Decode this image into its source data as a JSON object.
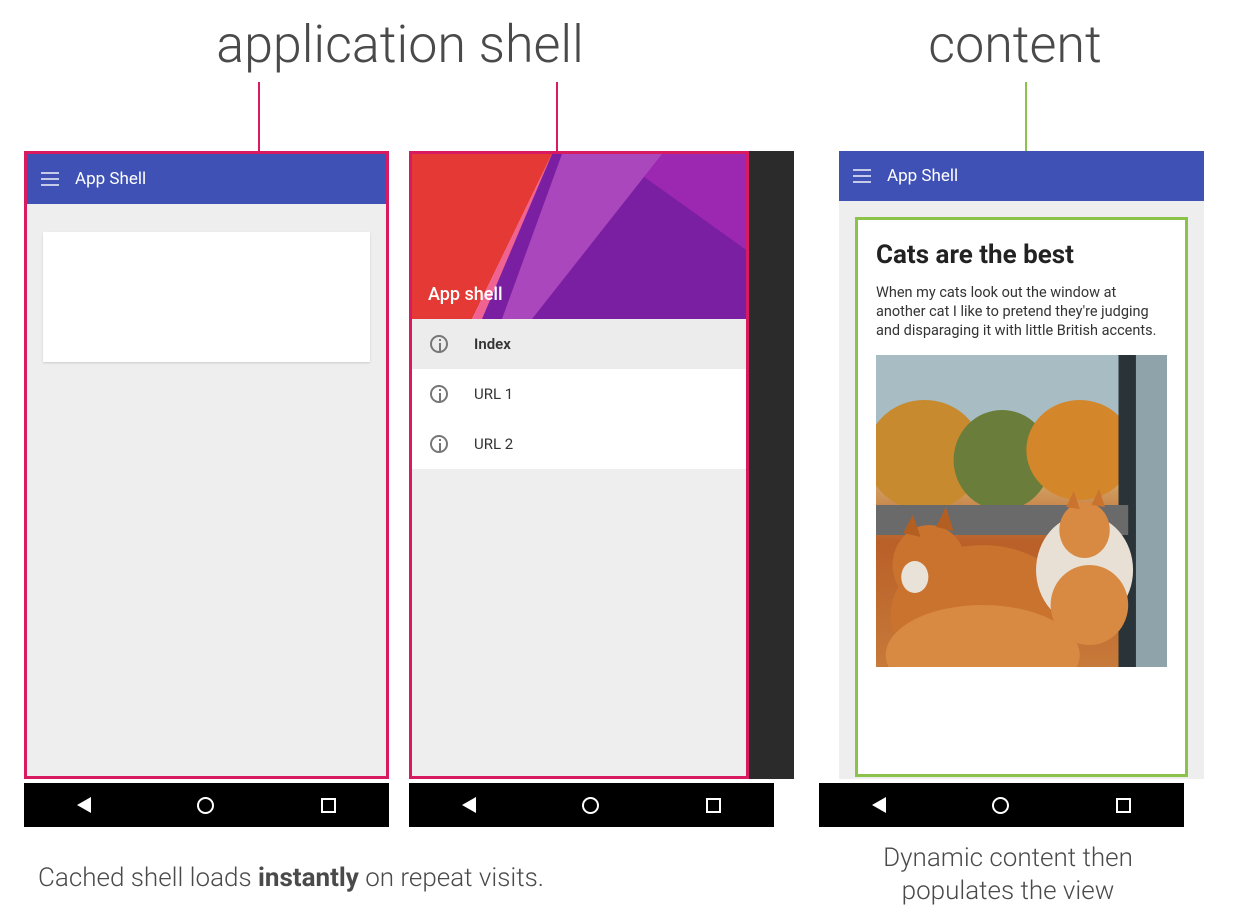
{
  "titles": {
    "left": "application shell",
    "right": "content"
  },
  "colors": {
    "appbar": "#3f51b5",
    "highlight_pink": "#d81b60",
    "highlight_green": "#8bc34a"
  },
  "appbar": {
    "title": "App Shell"
  },
  "drawer": {
    "header_title": "App shell",
    "items": [
      {
        "label": "Index",
        "active": true
      },
      {
        "label": "URL 1",
        "active": false
      },
      {
        "label": "URL 2",
        "active": false
      }
    ]
  },
  "content": {
    "heading": "Cats are the best",
    "body": "When my cats look out the window at another cat I like to pretend they're judging and disparaging it with little British accents.",
    "image_alt": "Two orange-and-white cats looking out a window at autumn foliage"
  },
  "captions": {
    "left_pre": "Cached shell loads ",
    "left_bold": "instantly",
    "left_post": " on repeat visits.",
    "right": "Dynamic content then populates the view"
  }
}
